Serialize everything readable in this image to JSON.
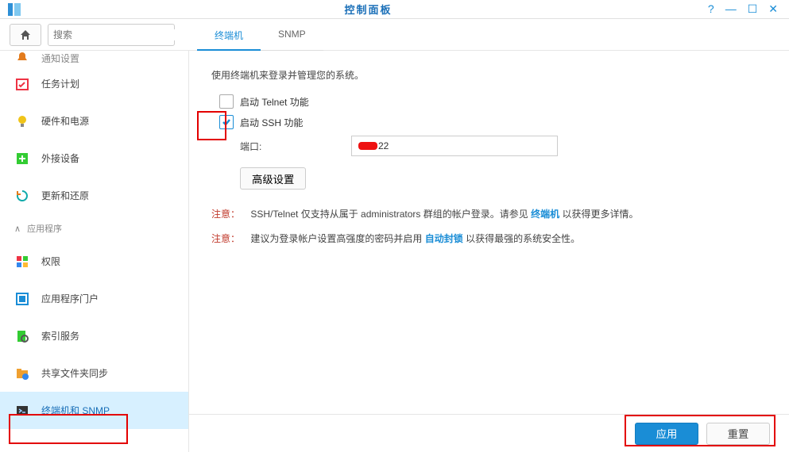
{
  "window": {
    "title": "控制面板"
  },
  "search": {
    "placeholder": "搜索"
  },
  "sidebar": {
    "truncated_label": "通知设置",
    "items": [
      {
        "label": "任务计划"
      },
      {
        "label": "硬件和电源"
      },
      {
        "label": "外接设备"
      },
      {
        "label": "更新和还原"
      }
    ],
    "section": "应用程序",
    "app_items": [
      {
        "label": "权限"
      },
      {
        "label": "应用程序门户"
      },
      {
        "label": "索引服务"
      },
      {
        "label": "共享文件夹同步"
      },
      {
        "label": "终端机和 SNMP"
      }
    ]
  },
  "tabs": {
    "terminal": "终端机",
    "snmp": "SNMP"
  },
  "main": {
    "intro": "使用终端机来登录并管理您的系统。",
    "telnet_label": "启动 Telnet 功能",
    "ssh_label": "启动 SSH 功能",
    "port_label": "端口:",
    "port_value": "22",
    "adv_button": "高级设置",
    "note1_prefix": "注意：",
    "note1_a": "SSH/Telnet 仅支持从属于 administrators 群组的帐户登录。请参见 ",
    "note1_link": "终端机",
    "note1_b": " 以获得更多详情。",
    "note2_a": "建议为登录帐户设置高强度的密码并启用 ",
    "note2_link": "自动封锁",
    "note2_b": " 以获得最强的系统安全性。"
  },
  "footer": {
    "apply": "应用",
    "reset": "重置"
  }
}
